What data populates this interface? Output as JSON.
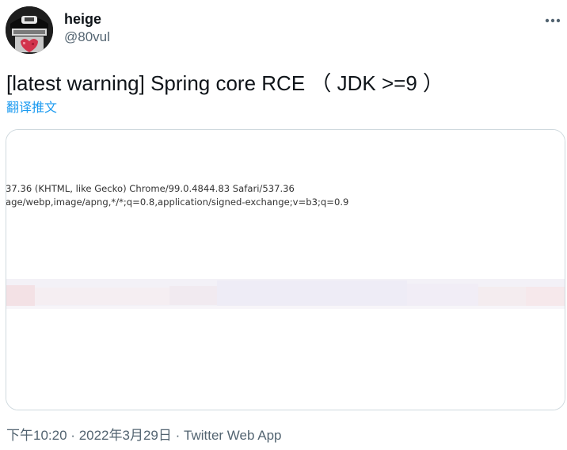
{
  "author": {
    "name": "heige",
    "handle": "@80vul"
  },
  "tweet": {
    "text": "[latest warning] Spring core RCE （ JDK >=9 ）",
    "translate_label": "翻译推文"
  },
  "media": {
    "lines": [
      "37.36 (KHTML, like Gecko) Chrome/99.0.4844.83 Safari/537.36",
      "age/webp,image/apng,*/*;q=0.8,application/signed-exchange;v=b3;q=0.9"
    ]
  },
  "meta": {
    "time": "下午10:20",
    "separator": "·",
    "date": "2022年3月29日",
    "source": "Twitter Web App"
  },
  "icons": {
    "more": "more-horizontal-icon"
  },
  "colors": {
    "accent": "#1d9bf0",
    "secondary_text": "#536471",
    "border": "#cfd9de"
  }
}
